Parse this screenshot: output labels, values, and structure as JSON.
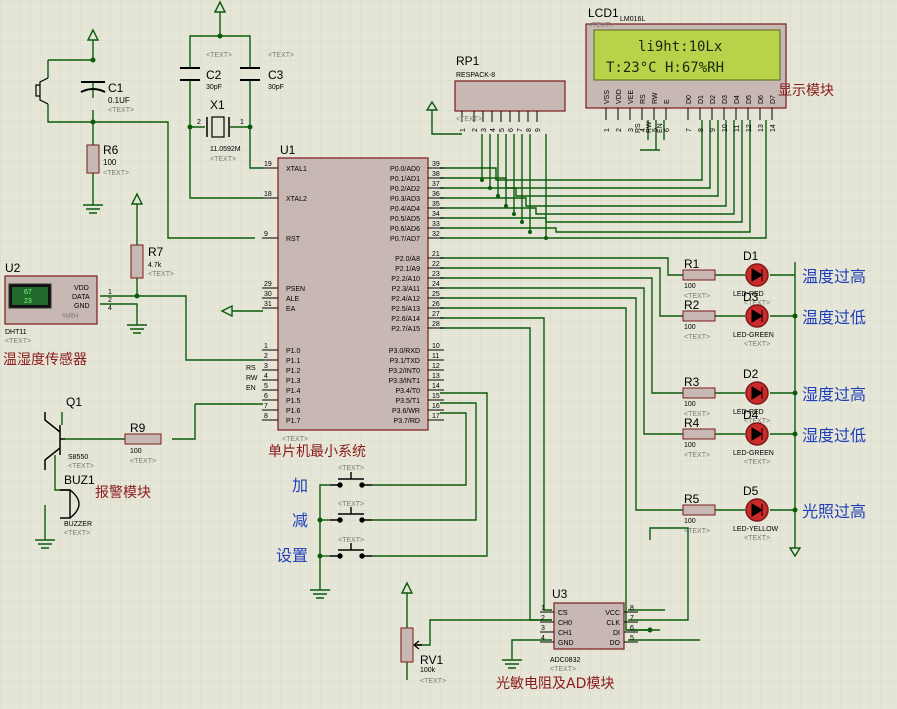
{
  "lcd": {
    "ref": "LCD1",
    "model": "LM016L",
    "line1": "li9ht:10Lx",
    "line2": "T:23°C   H:67%RH",
    "pins": [
      "VSS",
      "VDD",
      "VEE",
      "RS",
      "RW",
      "E",
      "D0",
      "D1",
      "D2",
      "D3",
      "D4",
      "D5",
      "D6",
      "D7"
    ],
    "pin_numbers": [
      "1",
      "2",
      "3",
      "4",
      "5",
      "6",
      "7",
      "8",
      "9",
      "10",
      "11",
      "12",
      "13",
      "14"
    ],
    "net_labels": [
      "RS",
      "RW",
      "EN"
    ],
    "module_label": "显示模块"
  },
  "rp1": {
    "ref": "RP1",
    "model": "RESPACK-8",
    "pins": [
      "1",
      "2",
      "3",
      "4",
      "5",
      "6",
      "7",
      "8",
      "9"
    ]
  },
  "c1": {
    "ref": "C1",
    "value": "0.1UF"
  },
  "c2": {
    "ref": "C2",
    "value": "30pF"
  },
  "c3": {
    "ref": "C3",
    "value": "30pF"
  },
  "x1": {
    "ref": "X1",
    "value": "11.0592M",
    "pin1": "1",
    "pin2": "2"
  },
  "r6": {
    "ref": "R6",
    "value": "100"
  },
  "r7": {
    "ref": "R7",
    "value": "4.7k"
  },
  "r9": {
    "ref": "R9",
    "value": "100"
  },
  "u1": {
    "ref": "U1",
    "label": "单片机最小系统",
    "left_pins": [
      {
        "num": "19",
        "name": "XTAL1"
      },
      {
        "num": "18",
        "name": "XTAL2"
      },
      {
        "num": "9",
        "name": "RST"
      },
      {
        "num": "29",
        "name": "PSEN"
      },
      {
        "num": "30",
        "name": "ALE"
      },
      {
        "num": "31",
        "name": "EA"
      },
      {
        "num": "1",
        "name": "P1.0"
      },
      {
        "num": "2",
        "name": "P1.1"
      },
      {
        "num": "3",
        "name": "P1.2"
      },
      {
        "num": "4",
        "name": "P1.3"
      },
      {
        "num": "5",
        "name": "P1.4"
      },
      {
        "num": "6",
        "name": "P1.5"
      },
      {
        "num": "7",
        "name": "P1.6"
      },
      {
        "num": "8",
        "name": "P1.7"
      }
    ],
    "right_pins": [
      {
        "num": "39",
        "name": "P0.0/AD0"
      },
      {
        "num": "38",
        "name": "P0.1/AD1"
      },
      {
        "num": "37",
        "name": "P0.2/AD2"
      },
      {
        "num": "36",
        "name": "P0.3/AD3"
      },
      {
        "num": "35",
        "name": "P0.4/AD4"
      },
      {
        "num": "34",
        "name": "P0.5/AD5"
      },
      {
        "num": "33",
        "name": "P0.6/AD6"
      },
      {
        "num": "32",
        "name": "P0.7/AD7"
      },
      {
        "num": "21",
        "name": "P2.0/A8"
      },
      {
        "num": "22",
        "name": "P2.1/A9"
      },
      {
        "num": "23",
        "name": "P2.2/A10"
      },
      {
        "num": "24",
        "name": "P2.3/A11"
      },
      {
        "num": "25",
        "name": "P2.4/A12"
      },
      {
        "num": "26",
        "name": "P2.5/A13"
      },
      {
        "num": "27",
        "name": "P2.6/A14"
      },
      {
        "num": "28",
        "name": "P2.7/A15"
      },
      {
        "num": "10",
        "name": "P3.0/RXD"
      },
      {
        "num": "11",
        "name": "P3.1/TXD"
      },
      {
        "num": "12",
        "name": "P3.2/INT0"
      },
      {
        "num": "13",
        "name": "P3.3/INT1"
      },
      {
        "num": "14",
        "name": "P3.4/T0"
      },
      {
        "num": "15",
        "name": "P3.5/T1"
      },
      {
        "num": "16",
        "name": "P3.6/WR"
      },
      {
        "num": "17",
        "name": "P3.7/RD"
      }
    ]
  },
  "u2": {
    "ref": "U2",
    "model": "DHT11",
    "display_top": "67",
    "display_bottom": "23",
    "unit": "%RH",
    "pins": [
      "VDD",
      "DATA",
      "GND"
    ],
    "pin_numbers": [
      "1",
      "2",
      "4"
    ],
    "label": "温湿度传感器"
  },
  "q1": {
    "ref": "Q1",
    "model": "S8550"
  },
  "buz1": {
    "ref": "BUZ1",
    "model": "BUZZER",
    "label": "报警模块"
  },
  "leds": [
    {
      "r_ref": "R1",
      "r_val": "100",
      "d_ref": "D1",
      "d_model": "LED-RED",
      "label": "温度过高"
    },
    {
      "r_ref": "R2",
      "r_val": "100",
      "d_ref": "D3",
      "d_model": "LED-GREEN",
      "label": "温度过低"
    },
    {
      "r_ref": "R3",
      "r_val": "100",
      "d_ref": "D2",
      "d_model": "LED-RED",
      "label": "湿度过高"
    },
    {
      "r_ref": "R4",
      "r_val": "100",
      "d_ref": "D4",
      "d_model": "LED-GREEN",
      "label": "湿度过低"
    },
    {
      "r_ref": "R5",
      "r_val": "100",
      "d_ref": "D5",
      "d_model": "LED-YELLOW",
      "label": "光照过高"
    }
  ],
  "buttons": [
    {
      "label": "加"
    },
    {
      "label": "减"
    },
    {
      "label": "设置"
    }
  ],
  "u3": {
    "ref": "U3",
    "model": "ADC0832",
    "left_pins": [
      {
        "num": "1",
        "name": "CS"
      },
      {
        "num": "2",
        "name": "CH0"
      },
      {
        "num": "3",
        "name": "CH1"
      },
      {
        "num": "4",
        "name": "GND"
      }
    ],
    "right_pins": [
      {
        "num": "8",
        "name": "VCC"
      },
      {
        "num": "7",
        "name": "CLK"
      },
      {
        "num": "6",
        "name": "DI"
      },
      {
        "num": "5",
        "name": "DO"
      }
    ],
    "label": "光敏电阻及AD模块"
  },
  "rv1": {
    "ref": "RV1",
    "value": "100k"
  },
  "placeholder": "<TEXT>",
  "colors": {
    "wire": "#0a5c0a",
    "body": "#c8b8b4",
    "outline": "#7a1a1a",
    "lcd_bg": "#b8d24a",
    "led_red": "#cc2a2a",
    "background": "#e6e6d8",
    "grid": "#d2d2c2"
  }
}
